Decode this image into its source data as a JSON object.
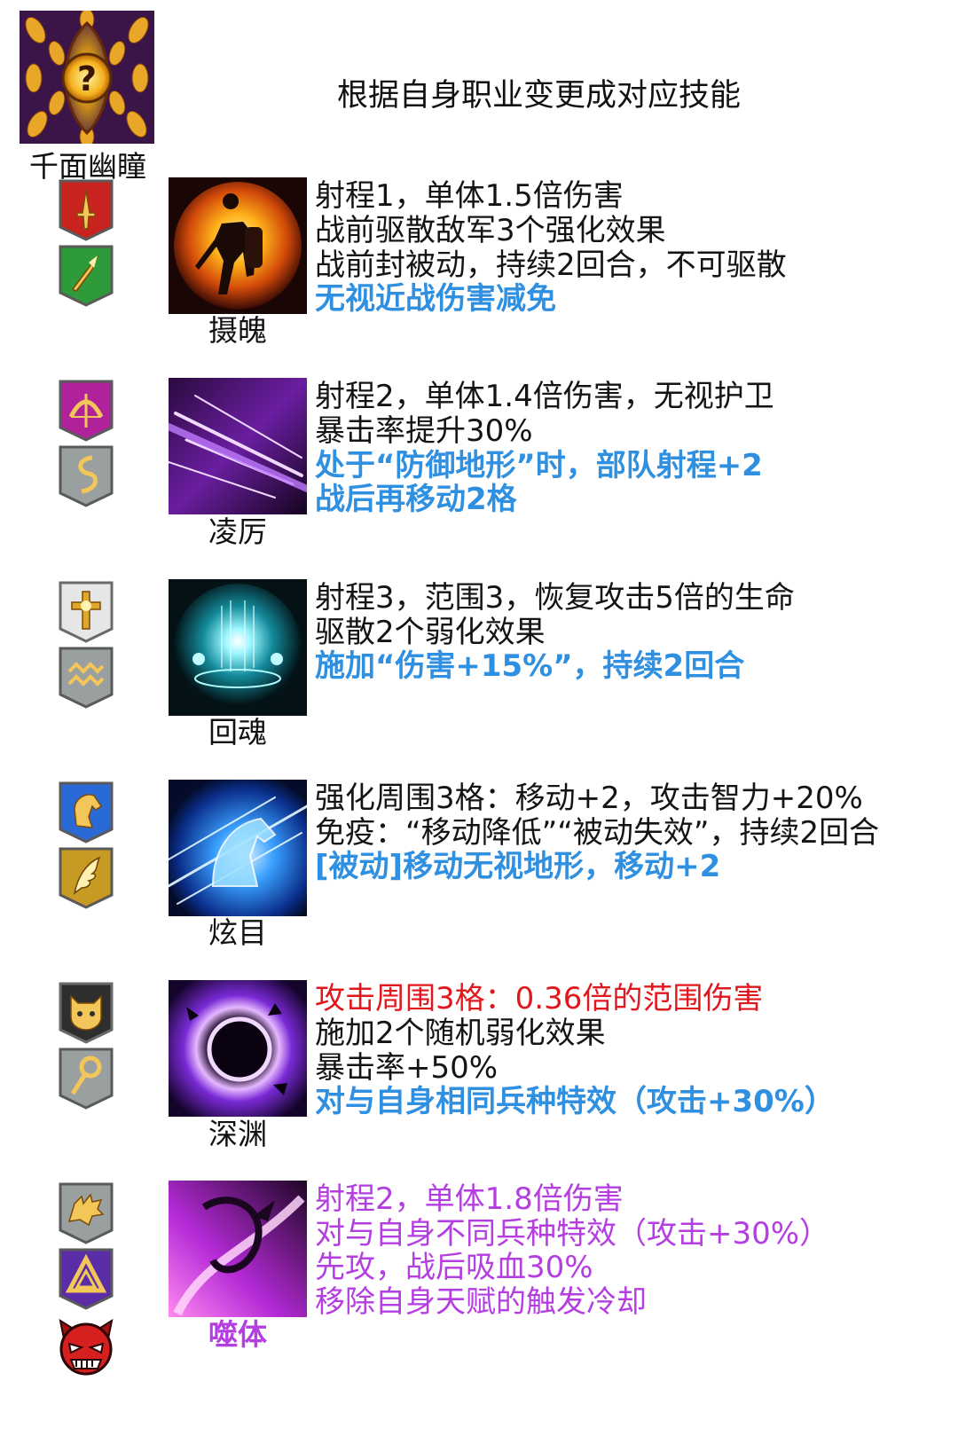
{
  "header": {
    "icon": "golden-eye-icon",
    "name": "千面幽瞳",
    "title": "根据自身职业变更成对应技能"
  },
  "skills": [
    {
      "name": "摄魄",
      "icon": "warrior-silhouette-icon",
      "class_badges": [
        "red-sword-badge",
        "green-spear-badge"
      ],
      "lines": [
        "射程1，单体1.5倍伤害",
        "战前驱散敌军3个强化效果",
        "战前封被动，持续2回合，不可驱散",
        "无视近战伤害减免"
      ]
    },
    {
      "name": "凌厉",
      "icon": "purple-slash-icon",
      "class_badges": [
        "magenta-bow-badge",
        "gray-serpent-badge"
      ],
      "lines": [
        "射程2，单体1.4倍伤害，无视护卫",
        "暴击率提升30%",
        "处于“防御地形”时，部队射程+2",
        "战后再移动2格"
      ]
    },
    {
      "name": "回魂",
      "icon": "cyan-healing-orb-icon",
      "class_badges": [
        "white-cross-badge",
        "gray-wave-badge"
      ],
      "lines": [
        "射程3，范围3，恢复攻击5倍的生命",
        "驱散2个弱化效果",
        "施加“伤害+15%”，持续2回合"
      ]
    },
    {
      "name": "炫目",
      "icon": "blue-spirit-horse-icon",
      "class_badges": [
        "blue-horse-badge",
        "gold-wing-badge"
      ],
      "lines": [
        "强化周围3格：移动+2，攻击智力+20%",
        "免疫：“移动降低”“被动失效”，持续2回合",
        "[被动]移动无视地形，移动+2"
      ]
    },
    {
      "name": "深渊",
      "icon": "dark-vortex-icon",
      "class_badges": [
        "black-cat-badge",
        "gray-staff-badge"
      ],
      "lines": [
        "攻击周围3格：0.36倍的范围伤害",
        "施加2个随机弱化效果",
        "暴击率+50%",
        "对与自身相同兵种特效（攻击+30%）"
      ]
    },
    {
      "name": "噬体",
      "icon": "purple-dragon-claw-icon",
      "class_badges": [
        "gray-dragon-badge",
        "purple-triangle-badge",
        "red-demon-face-icon"
      ],
      "lines": [
        "射程2，单体1.8倍伤害",
        "对与自身不同兵种特效（攻击+30%）",
        "先攻，战后吸血30%",
        "移除自身天赋的触发冷却"
      ]
    }
  ],
  "colors": {
    "blue_text": "#2f8fe0",
    "red_text": "#e0181e",
    "purple_text": "#b43ee0",
    "black_text": "#141414"
  }
}
